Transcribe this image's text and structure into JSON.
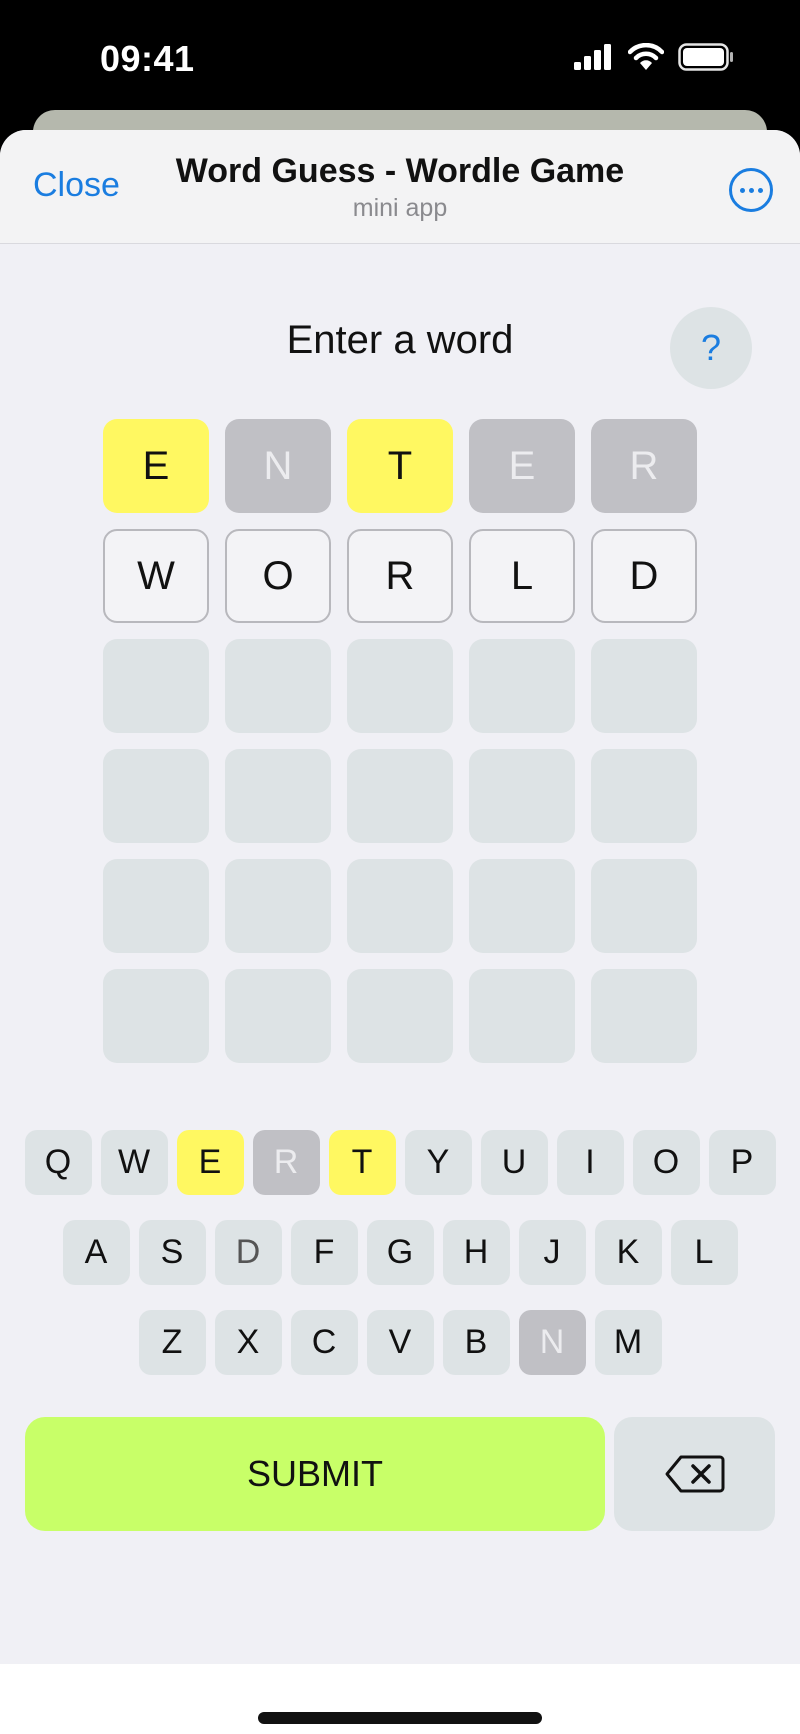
{
  "status_bar": {
    "time": "09:41"
  },
  "header": {
    "close_label": "Close",
    "title": "Word Guess - Wordle Game",
    "subtitle": "mini app"
  },
  "game": {
    "heading": "Enter a word",
    "help_label": "?",
    "rows": [
      [
        {
          "letter": "E",
          "state": "present"
        },
        {
          "letter": "N",
          "state": "absent"
        },
        {
          "letter": "T",
          "state": "present"
        },
        {
          "letter": "E",
          "state": "absent"
        },
        {
          "letter": "R",
          "state": "absent"
        }
      ],
      [
        {
          "letter": "W",
          "state": "typed"
        },
        {
          "letter": "O",
          "state": "typed"
        },
        {
          "letter": "R",
          "state": "typed"
        },
        {
          "letter": "L",
          "state": "typed"
        },
        {
          "letter": "D",
          "state": "typed"
        }
      ],
      [
        {
          "letter": "",
          "state": "empty"
        },
        {
          "letter": "",
          "state": "empty"
        },
        {
          "letter": "",
          "state": "empty"
        },
        {
          "letter": "",
          "state": "empty"
        },
        {
          "letter": "",
          "state": "empty"
        }
      ],
      [
        {
          "letter": "",
          "state": "empty"
        },
        {
          "letter": "",
          "state": "empty"
        },
        {
          "letter": "",
          "state": "empty"
        },
        {
          "letter": "",
          "state": "empty"
        },
        {
          "letter": "",
          "state": "empty"
        }
      ],
      [
        {
          "letter": "",
          "state": "empty"
        },
        {
          "letter": "",
          "state": "empty"
        },
        {
          "letter": "",
          "state": "empty"
        },
        {
          "letter": "",
          "state": "empty"
        },
        {
          "letter": "",
          "state": "empty"
        }
      ],
      [
        {
          "letter": "",
          "state": "empty"
        },
        {
          "letter": "",
          "state": "empty"
        },
        {
          "letter": "",
          "state": "empty"
        },
        {
          "letter": "",
          "state": "empty"
        },
        {
          "letter": "",
          "state": "empty"
        }
      ]
    ]
  },
  "keyboard": {
    "rows": [
      [
        {
          "key": "Q",
          "state": "normal"
        },
        {
          "key": "W",
          "state": "normal"
        },
        {
          "key": "E",
          "state": "present"
        },
        {
          "key": "R",
          "state": "absent"
        },
        {
          "key": "T",
          "state": "present"
        },
        {
          "key": "Y",
          "state": "normal"
        },
        {
          "key": "U",
          "state": "normal"
        },
        {
          "key": "I",
          "state": "normal"
        },
        {
          "key": "O",
          "state": "normal"
        },
        {
          "key": "P",
          "state": "normal"
        }
      ],
      [
        {
          "key": "A",
          "state": "normal"
        },
        {
          "key": "S",
          "state": "normal"
        },
        {
          "key": "D",
          "state": "dim"
        },
        {
          "key": "F",
          "state": "normal"
        },
        {
          "key": "G",
          "state": "normal"
        },
        {
          "key": "H",
          "state": "normal"
        },
        {
          "key": "J",
          "state": "normal"
        },
        {
          "key": "K",
          "state": "normal"
        },
        {
          "key": "L",
          "state": "normal"
        }
      ],
      [
        {
          "key": "Z",
          "state": "normal"
        },
        {
          "key": "X",
          "state": "normal"
        },
        {
          "key": "C",
          "state": "normal"
        },
        {
          "key": "V",
          "state": "normal"
        },
        {
          "key": "B",
          "state": "normal"
        },
        {
          "key": "N",
          "state": "absent"
        },
        {
          "key": "M",
          "state": "normal"
        }
      ]
    ],
    "submit_label": "SUBMIT",
    "backspace_icon": "backspace-icon"
  },
  "colors": {
    "accent_blue": "#1a7de0",
    "present_yellow": "#fff861",
    "absent_gray": "#c0c0c5",
    "submit_green": "#c8ff68"
  }
}
